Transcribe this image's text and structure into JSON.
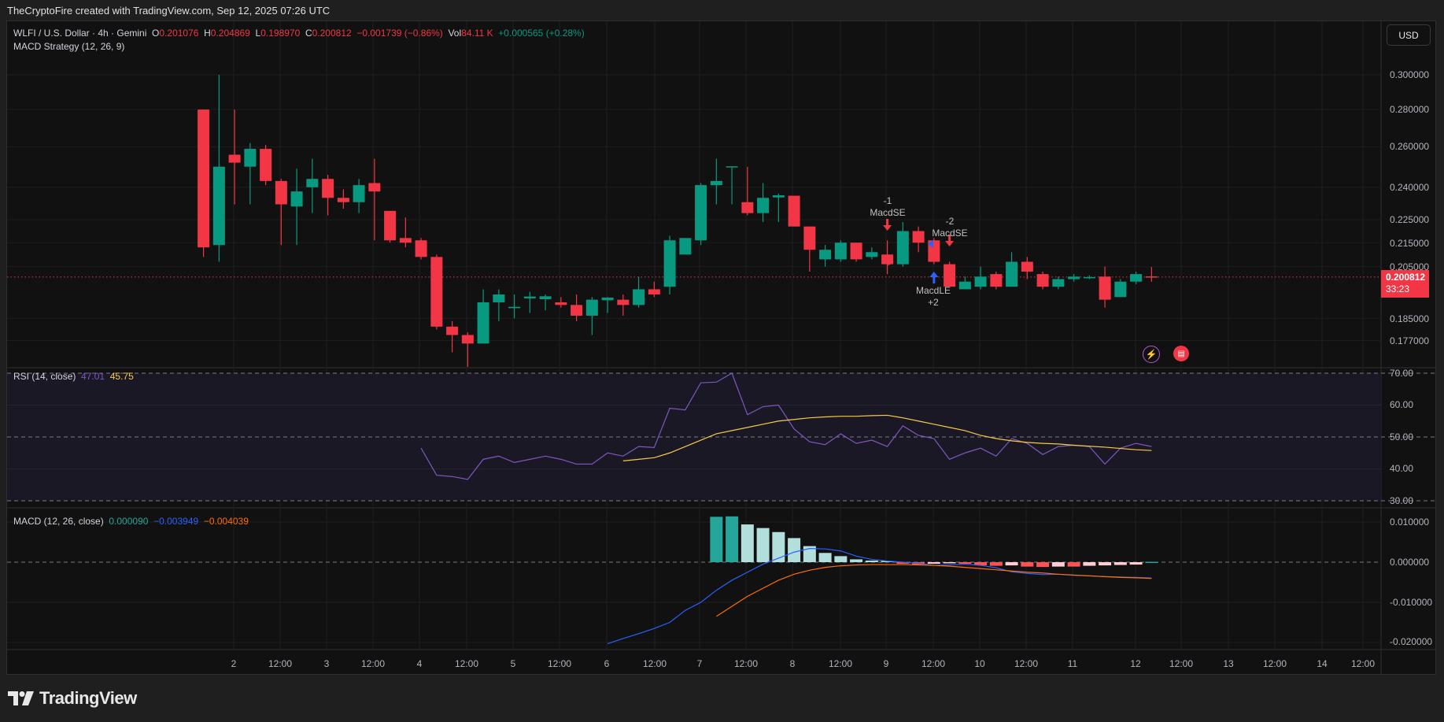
{
  "credit": "TheCryptoFire created with TradingView.com, Sep 12, 2025 07:26 UTC",
  "symbol": {
    "title": "WLFI / U.S. Dollar · 4h · Gemini",
    "o_label": "O",
    "o": "0.201076",
    "h_label": "H",
    "h": "0.204869",
    "l_label": "L",
    "l": "0.198970",
    "c_label": "C",
    "c": "0.200812",
    "change": "−0.001739 (−0.86%)",
    "vol_label": "Vol",
    "vol": "84.11 K",
    "vol_change": "+0.000565 (+0.28%)"
  },
  "strategy": "MACD Strategy (12, 26, 9)",
  "currency_button": "USD",
  "price_axis": [
    "0.300000",
    "0.280000",
    "0.260000",
    "0.240000",
    "0.225000",
    "0.215000",
    "0.205000",
    "0.185000",
    "0.177000"
  ],
  "last_price": {
    "value": "0.200812",
    "countdown": "33:23"
  },
  "rsi": {
    "title": "RSI (14, close)",
    "value": "47.01",
    "ma_value": "45.75",
    "axis": [
      "70.00",
      "60.00",
      "50.00",
      "40.00",
      "30.00"
    ]
  },
  "macd": {
    "title": "MACD (12, 26, close)",
    "hist_value": "0.000090",
    "macd_value": "−0.003949",
    "signal_value": "−0.004039",
    "axis": [
      "0.010000",
      "0.000000",
      "-0.010000",
      "-0.020000"
    ]
  },
  "time_axis": [
    "2",
    "12:00",
    "3",
    "12:00",
    "4",
    "12:00",
    "5",
    "12:00",
    "6",
    "12:00",
    "7",
    "12:00",
    "8",
    "12:00",
    "9",
    "12:00",
    "10",
    "12:00",
    "11",
    "12",
    "12:00",
    "13",
    "12:00",
    "14",
    "12:00"
  ],
  "signals": [
    {
      "qty": "-1",
      "name": "MacdSE"
    },
    {
      "qty": "-2",
      "name": "MacdSE"
    },
    {
      "name": "MacdLE",
      "qty": "+2"
    }
  ],
  "brand": "TradingView",
  "colors": {
    "up": "#089981",
    "down": "#f23645",
    "rsi": "#7e57c2",
    "rsi_ma": "#f7c948",
    "macd": "#2962ff",
    "signal": "#ff6d00"
  },
  "chart_data": {
    "type": "candlestick",
    "candles_ohlc": [
      [
        0.28,
        0.28,
        0.209,
        0.213
      ],
      [
        0.214,
        0.3,
        0.207,
        0.25
      ],
      [
        0.256,
        0.28,
        0.232,
        0.252
      ],
      [
        0.25,
        0.262,
        0.232,
        0.259
      ],
      [
        0.259,
        0.261,
        0.241,
        0.243
      ],
      [
        0.243,
        0.244,
        0.214,
        0.232
      ],
      [
        0.231,
        0.249,
        0.214,
        0.238
      ],
      [
        0.24,
        0.254,
        0.228,
        0.244
      ],
      [
        0.244,
        0.246,
        0.227,
        0.235
      ],
      [
        0.235,
        0.239,
        0.23,
        0.233
      ],
      [
        0.233,
        0.244,
        0.228,
        0.241
      ],
      [
        0.242,
        0.254,
        0.216,
        0.238
      ],
      [
        0.229,
        0.229,
        0.215,
        0.216
      ],
      [
        0.217,
        0.226,
        0.213,
        0.215
      ],
      [
        0.216,
        0.217,
        0.208,
        0.209
      ],
      [
        0.209,
        0.21,
        0.181,
        0.182
      ],
      [
        0.182,
        0.184,
        0.173,
        0.179
      ],
      [
        0.179,
        0.18,
        0.168,
        0.176
      ],
      [
        0.176,
        0.196,
        0.176,
        0.191
      ],
      [
        0.191,
        0.196,
        0.184,
        0.194
      ],
      [
        0.1888,
        0.194,
        0.185,
        0.1893
      ],
      [
        0.1925,
        0.195,
        0.187,
        0.1932
      ],
      [
        0.1922,
        0.194,
        0.188,
        0.1933
      ],
      [
        0.191,
        0.193,
        0.189,
        0.19
      ],
      [
        0.19,
        0.194,
        0.184,
        0.186
      ],
      [
        0.186,
        0.193,
        0.179,
        0.192
      ],
      [
        0.1918,
        0.193,
        0.187,
        0.1928
      ],
      [
        0.192,
        0.194,
        0.186,
        0.19
      ],
      [
        0.19,
        0.201,
        0.189,
        0.196
      ],
      [
        0.196,
        0.199,
        0.193,
        0.194
      ],
      [
        0.197,
        0.218,
        0.194,
        0.216
      ],
      [
        0.21,
        0.217,
        0.21,
        0.217
      ],
      [
        0.216,
        0.242,
        0.214,
        0.241
      ],
      [
        0.241,
        0.254,
        0.232,
        0.243
      ],
      [
        0.25,
        0.25,
        0.232,
        0.2502
      ],
      [
        0.233,
        0.25,
        0.227,
        0.228
      ],
      [
        0.228,
        0.242,
        0.224,
        0.235
      ],
      [
        0.2352,
        0.237,
        0.224,
        0.2362
      ],
      [
        0.236,
        0.236,
        0.222,
        0.222
      ],
      [
        0.222,
        0.222,
        0.203,
        0.212
      ],
      [
        0.208,
        0.214,
        0.205,
        0.212
      ],
      [
        0.208,
        0.216,
        0.207,
        0.215
      ],
      [
        0.215,
        0.215,
        0.207,
        0.208
      ],
      [
        0.209,
        0.213,
        0.208,
        0.211
      ],
      [
        0.21,
        0.216,
        0.202,
        0.206
      ],
      [
        0.206,
        0.224,
        0.205,
        0.22
      ],
      [
        0.22,
        0.222,
        0.211,
        0.215
      ],
      [
        0.216,
        0.217,
        0.206,
        0.207
      ],
      [
        0.206,
        0.207,
        0.197,
        0.197
      ],
      [
        0.196,
        0.201,
        0.196,
        0.199
      ],
      [
        0.197,
        0.205,
        0.196,
        0.201
      ],
      [
        0.202,
        0.203,
        0.196,
        0.197
      ],
      [
        0.197,
        0.211,
        0.197,
        0.207
      ],
      [
        0.207,
        0.209,
        0.2,
        0.203
      ],
      [
        0.202,
        0.203,
        0.196,
        0.197
      ],
      [
        0.197,
        0.201,
        0.196,
        0.2
      ],
      [
        0.2,
        0.202,
        0.199,
        0.201
      ],
      [
        0.2005,
        0.2015,
        0.2,
        0.2008
      ],
      [
        0.201,
        0.205,
        0.189,
        0.192
      ],
      [
        0.193,
        0.2,
        0.193,
        0.199
      ],
      [
        0.199,
        0.203,
        0.198,
        0.202
      ],
      [
        0.201076,
        0.204869,
        0.19897,
        0.200812
      ]
    ],
    "rsi_start_index": 14,
    "rsi": [
      46.5,
      38,
      37.6,
      36.7,
      43,
      44,
      42,
      43,
      44,
      43,
      41.5,
      41.5,
      45,
      44,
      47,
      46.7,
      59,
      58.5,
      67,
      67.2,
      70,
      57,
      59.5,
      60,
      52.5,
      48.5,
      47.6,
      51,
      48,
      49,
      47,
      53.5,
      50.5,
      49.5,
      43,
      45,
      46.5,
      44,
      49.5,
      48,
      44.5,
      47,
      47.4,
      47,
      41.5,
      46.5,
      48,
      47.01
    ],
    "rsi_ma_start_index": 27,
    "rsi_ma": [
      42.5,
      43,
      43.5,
      45,
      47,
      49,
      51,
      52,
      53,
      54,
      55,
      55.5,
      56,
      56.3,
      56.5,
      56.5,
      56.7,
      56.8,
      56,
      55,
      54,
      53,
      52,
      50.5,
      49.5,
      48.8,
      48.3,
      48,
      47.8,
      47.4,
      47.1,
      46.8,
      46.4,
      46,
      45.75
    ],
    "macd_start_index": 26,
    "macd_line": [
      -0.0203,
      -0.019,
      -0.0178,
      -0.0165,
      -0.015,
      -0.012,
      -0.01,
      -0.007,
      -0.0045,
      -0.0025,
      -0.0005,
      0.001,
      0.0025,
      0.0034,
      0.0033,
      0.0028,
      0.0015,
      0.0007,
      0.0003,
      0.0,
      -0.0003,
      -0.0008,
      -0.0007,
      -0.0005,
      -0.0008,
      -0.0014,
      -0.0024,
      -0.0028,
      -0.0031,
      -0.003,
      -0.0033,
      -0.0034,
      -0.0036,
      -0.0037,
      -0.0038,
      -0.003949
    ],
    "signal_start_index": 33,
    "signal_line": [
      -0.0135,
      -0.011,
      -0.0085,
      -0.0065,
      -0.0045,
      -0.003,
      -0.002,
      -0.0013,
      -0.0009,
      -0.0007,
      -0.0006,
      -0.0006,
      -0.0006,
      -0.0007,
      -0.0008,
      -0.001,
      -0.0013,
      -0.0016,
      -0.0019,
      -0.0022,
      -0.0025,
      -0.0027,
      -0.003,
      -0.0032,
      -0.0034,
      -0.0036,
      -0.0038,
      -0.0039,
      -0.004039
    ],
    "histogram": [
      0.0113,
      0.0114,
      0.0094,
      0.0085,
      0.0075,
      0.006,
      0.004,
      0.0023,
      0.0015,
      0.0007,
      0.0004,
      0.0003,
      -0.0004,
      -0.0006,
      -0.0004,
      -0.0003,
      -0.0004,
      -0.0008,
      -0.0009,
      -0.0008,
      -0.0011,
      -0.0012,
      -0.0011,
      -0.0011,
      -0.0009,
      -0.0008,
      -0.0007,
      -0.0006,
      9e-05
    ],
    "price_scale": "log",
    "rsi_levels": [
      70,
      50,
      30
    ]
  }
}
